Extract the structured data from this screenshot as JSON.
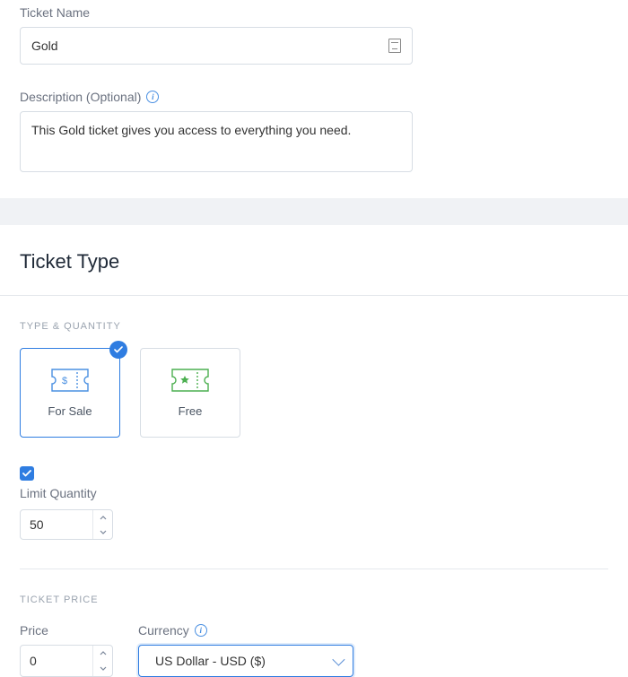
{
  "ticket_name": {
    "label": "Ticket Name",
    "value": "Gold"
  },
  "description": {
    "label": "Description (Optional)",
    "value": "This Gold ticket gives you access to everything you need."
  },
  "ticket_type": {
    "heading": "Ticket Type"
  },
  "type_quantity": {
    "subhead": "Type & Quantity",
    "cards": [
      {
        "label": "For Sale",
        "selected": true
      },
      {
        "label": "Free",
        "selected": false
      }
    ]
  },
  "limit_quantity": {
    "checked": true,
    "label": "Limit Quantity",
    "value": "50"
  },
  "ticket_price": {
    "subhead": "Ticket Price",
    "price": {
      "label": "Price",
      "value": "0"
    },
    "currency": {
      "label": "Currency",
      "selected": "US Dollar - USD ($)"
    }
  }
}
